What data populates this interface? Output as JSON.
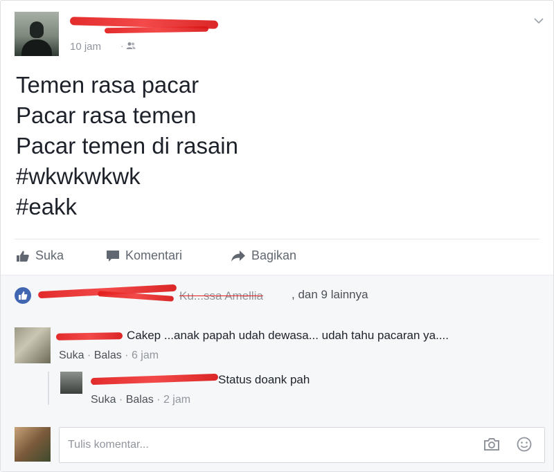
{
  "post": {
    "time": "10 jam",
    "separator": "·",
    "privacy_icon": "friends-icon",
    "lines": [
      "Temen rasa pacar",
      "Pacar rasa temen",
      "Pacar temen di rasain",
      "#wkwkwkwk",
      "#eakk"
    ]
  },
  "actions": {
    "like": "Suka",
    "comment": "Komentari",
    "share": "Bagikan"
  },
  "reactions": {
    "names": "Ku...ssa Amellia",
    "tail": ", dan 9 lainnya"
  },
  "comments": [
    {
      "text": "Cakep ...anak papah udah dewasa... udah tahu pacaran ya....",
      "like": "Suka",
      "reply": "Balas",
      "time": "6 jam"
    },
    {
      "text": "Status doank pah",
      "like": "Suka",
      "reply": "Balas",
      "time": "2 jam"
    }
  ],
  "composer": {
    "placeholder": "Tulis komentar..."
  },
  "colors": {
    "accent": "#4267b2",
    "redaction": "#e11a1a",
    "muted": "#90949c"
  }
}
